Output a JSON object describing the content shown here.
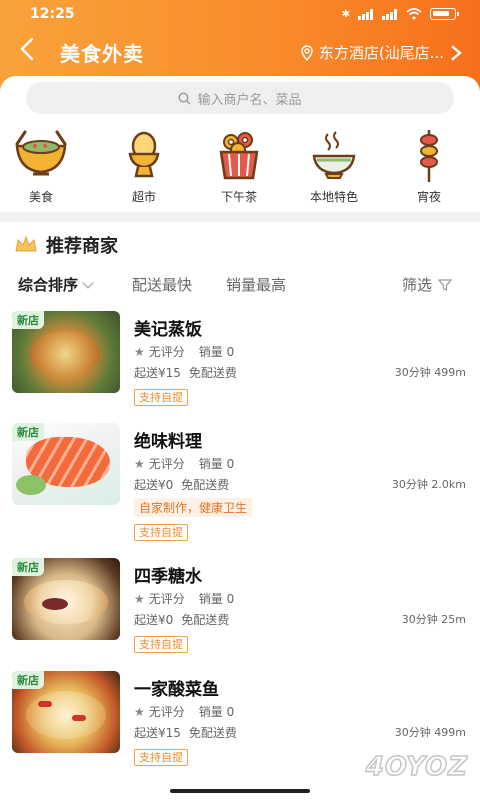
{
  "status": {
    "time": "12:25"
  },
  "nav": {
    "title": "美食外卖",
    "location": "东方酒店(汕尾店..."
  },
  "search": {
    "placeholder": "输入商户名、菜品"
  },
  "categories": [
    {
      "label": "美食",
      "icon": "salad-bowl-icon"
    },
    {
      "label": "超市",
      "icon": "egg-cup-icon"
    },
    {
      "label": "下午茶",
      "icon": "donut-box-icon"
    },
    {
      "label": "本地特色",
      "icon": "steaming-bowl-icon"
    },
    {
      "label": "宵夜",
      "icon": "skewer-icon"
    }
  ],
  "section": {
    "title": "推荐商家"
  },
  "sort": {
    "comprehensive": "综合排序",
    "fastest": "配送最快",
    "top_sales": "销量最高",
    "filter": "筛选"
  },
  "shops": [
    {
      "tag": "新店",
      "name": "美记蒸饭",
      "rating": "无评分",
      "sales": "销量 0",
      "min_order": "起送¥15",
      "delivery_fee": "免配送费",
      "time_dist": "30分钟 499m",
      "promo": "",
      "pickup": "支持自提"
    },
    {
      "tag": "新店",
      "name": "绝味料理",
      "rating": "无评分",
      "sales": "销量 0",
      "min_order": "起送¥0",
      "delivery_fee": "免配送费",
      "time_dist": "30分钟 2.0km",
      "promo": "自家制作，健康卫生",
      "pickup": "支持自提"
    },
    {
      "tag": "新店",
      "name": "四季糖水",
      "rating": "无评分",
      "sales": "销量 0",
      "min_order": "起送¥0",
      "delivery_fee": "免配送费",
      "time_dist": "30分钟 25m",
      "promo": "",
      "pickup": "支持自提"
    },
    {
      "tag": "新店",
      "name": "一家酸菜鱼",
      "rating": "无评分",
      "sales": "销量 0",
      "min_order": "起送¥15",
      "delivery_fee": "免配送费",
      "time_dist": "30分钟 499m",
      "promo": "",
      "pickup": "支持自提"
    }
  ],
  "watermark": "4OYOZ",
  "colors": {
    "header_start": "#f9a23a",
    "header_end": "#f76f1c",
    "accent": "#e98a2e"
  }
}
